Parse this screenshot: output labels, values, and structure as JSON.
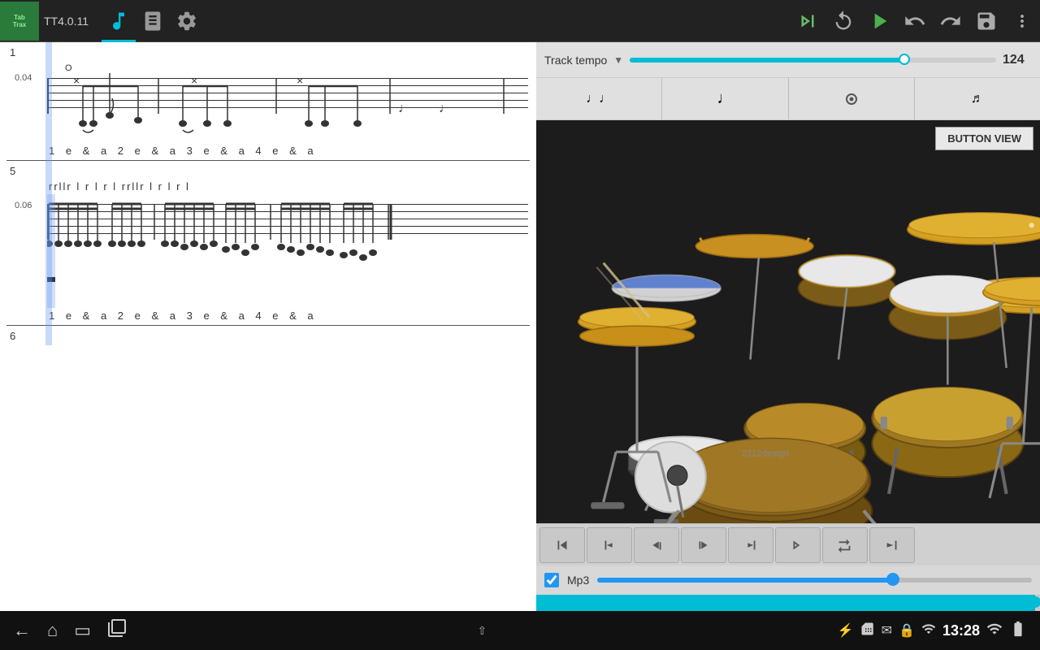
{
  "app": {
    "name": "TabTrax",
    "version": "TT4.0.11"
  },
  "topbar": {
    "icons": [
      "music-note",
      "book",
      "settings"
    ],
    "right_icons": [
      "step-play",
      "loop",
      "play",
      "undo",
      "redo",
      "save",
      "more"
    ]
  },
  "tempo": {
    "label": "Track tempo",
    "value": "124",
    "slider_pct": 75
  },
  "note_buttons": [
    "♩♩",
    "♩",
    "(·)",
    "♩̇"
  ],
  "button_view_label": "BUTTON VIEW",
  "playback": {
    "buttons": [
      "⇤",
      "←↩",
      "←↩",
      "↩→",
      "↩→→",
      "→↩",
      "↩→",
      "⇥"
    ]
  },
  "mp3": {
    "label": "Mp3",
    "checked": true,
    "slider_pct": 68
  },
  "sheet": {
    "measure1": "1",
    "beat_text1": "0.04",
    "counting1": "1 e & a 2 e & a 3 e & a 4 e & a",
    "measure2": "5",
    "sticking": "rrllr  l  r  l  r  l  rrllr  l  r  l  r  l",
    "beat_text2": "0.06",
    "counting2": "1 e & a 2 e & a 3 e & a 4 e & a",
    "measure3": "6"
  },
  "statusbar": {
    "time": "13:28",
    "icons": [
      "back",
      "home",
      "recent",
      "screenshot"
    ],
    "right_icons": [
      "usb",
      "sim",
      "email",
      "lock",
      "signal",
      "wifi",
      "battery"
    ]
  }
}
